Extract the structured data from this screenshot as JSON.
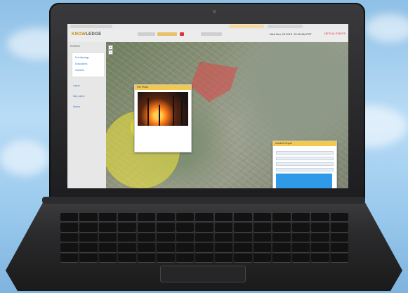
{
  "app": {
    "brand_prefix": "",
    "brand_bold": "KNOW",
    "brand_rest": "LEDGE",
    "datetime": "Wed Nov 25 2015",
    "time_readout": "10:45 AM PST",
    "alert_text": "CRITICAL EVENTS"
  },
  "sidebar": {
    "title": "EVENTS",
    "menu": [
      "Fire Warnings",
      "Evacuations",
      "Incidents"
    ],
    "items": [
      "Layers",
      "Map Layers",
      "Search"
    ]
  },
  "map": {
    "zoom_in": "+",
    "zoom_out": "−"
  },
  "popups": {
    "photo_title": "Fire Photo",
    "form_title": "Incident Report"
  },
  "colors": {
    "header_accent": "#c48c16",
    "popup_header": "#f2c94c",
    "zone_yellow": "#f0e63c",
    "zone_red": "#dc4646",
    "form_blue": "#2f9be8"
  }
}
